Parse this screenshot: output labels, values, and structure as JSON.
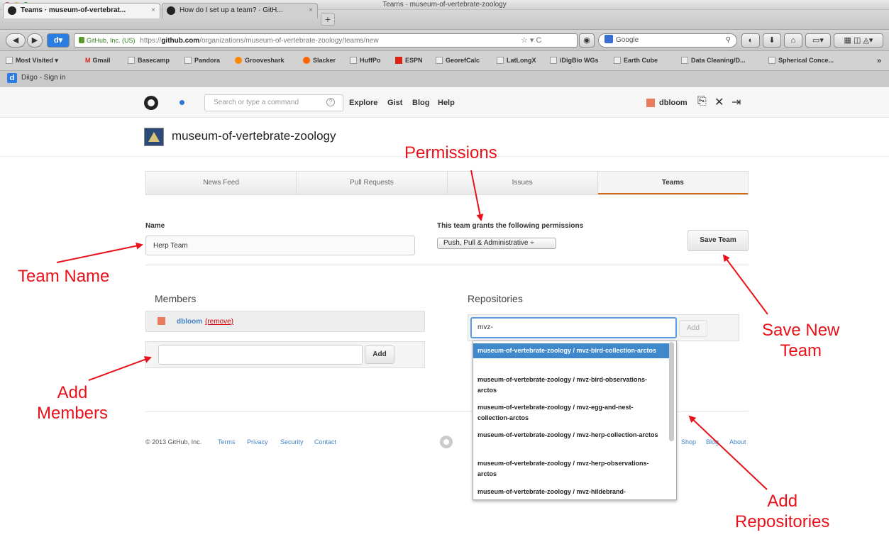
{
  "browser": {
    "window_title": "Teams · museum-of-vertebrate-zoology",
    "tabs": [
      {
        "label": "Teams · museum-of-vertebrat...",
        "close": "×"
      },
      {
        "label": "How do I set up a team? · GitH...",
        "close": "×"
      }
    ],
    "new_tab": "+",
    "identity": "GitHub, Inc. (US)",
    "url_prefix": "https://",
    "url_host": "github.com",
    "url_path": "/organizations/museum-of-vertebrate-zoology/teams/new",
    "search_engine_placeholder": "Google",
    "bookmarks": [
      "Most Visited ▾",
      "Gmail",
      "Basecamp",
      "Pandora",
      "Grooveshark",
      "Slacker",
      "HuffPo",
      "ESPN",
      "GeorefCalc",
      "LatLongX",
      "iDigBio WGs",
      "Earth Cube",
      "Data Cleaning/D...",
      "Spherical Conce..."
    ],
    "bookmarks_overflow": "»",
    "diigo_label": "Diigo - Sign in"
  },
  "github_header": {
    "search_placeholder": "Search or type a command",
    "nav": [
      "Explore",
      "Gist",
      "Blog",
      "Help"
    ],
    "username": "dbloom"
  },
  "org": {
    "name": "museum-of-vertebrate-zoology"
  },
  "page_tabs": [
    "News Feed",
    "Pull Requests",
    "Issues",
    "Teams"
  ],
  "form": {
    "name_label": "Name",
    "name_value": "Herp Team",
    "permissions_label": "This team grants the following permissions",
    "permissions_value": "Push, Pull & Administrative  ÷",
    "save_label": "Save Team"
  },
  "members": {
    "heading": "Members",
    "member_name": "dbloom",
    "remove_label": "(remove)",
    "add_label": "Add"
  },
  "repositories": {
    "heading": "Repositories",
    "input_value": "mvz-",
    "add_label": "Add",
    "suggestions": [
      "museum-of-vertebrate-zoology / mvz-bird-collection-arctos",
      "museum-of-vertebrate-zoology / mvz-bird-observations-arctos",
      "museum-of-vertebrate-zoology / mvz-egg-and-nest-collection-arctos",
      "museum-of-vertebrate-zoology / mvz-herp-collection-arctos",
      "museum-of-vertebrate-zoology / mvz-herp-observations-arctos",
      "museum-of-vertebrate-zoology / mvz-hildebrand-"
    ]
  },
  "footer": {
    "copyright": "© 2013 GitHub, Inc.",
    "left_links": [
      "Terms",
      "Privacy",
      "Security",
      "Contact"
    ],
    "right_links": [
      "Shop",
      "Blog",
      "About"
    ]
  },
  "annotations": {
    "permissions": "Permissions",
    "team_name": "Team Name",
    "save_new_team": "Save New\nTeam",
    "add_members": "Add\nMembers",
    "add_repositories": "Add\nRepositories",
    "color": "#e8121b"
  }
}
